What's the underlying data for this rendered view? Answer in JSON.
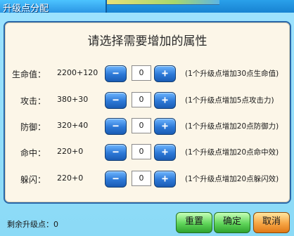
{
  "window": {
    "title": "升级点分配"
  },
  "panel": {
    "heading": "请选择需要增加的属性"
  },
  "attributes": [
    {
      "label": "生命值：",
      "value": "2200+120",
      "qty": "0",
      "note": "(1个升级点增加30点生命值)"
    },
    {
      "label": "攻击：",
      "value": "380+30",
      "qty": "0",
      "note": "(1个升级点增加5点攻击力)"
    },
    {
      "label": "防御：",
      "value": "320+40",
      "qty": "0",
      "note": "(1个升级点增加20点防御力)"
    },
    {
      "label": "命中：",
      "value": "220+0",
      "qty": "0",
      "note": "(1个升级点增加20点命中效)"
    },
    {
      "label": "躲闪：",
      "value": "220+0",
      "qty": "0",
      "note": "(1个升级点增加20点躲闪效)"
    }
  ],
  "controls": {
    "minus": "−",
    "plus": "+"
  },
  "footer": {
    "remaining": "剩余升级点：0",
    "reset_label": "重置",
    "confirm_label": "确定",
    "cancel_label": "取消"
  }
}
